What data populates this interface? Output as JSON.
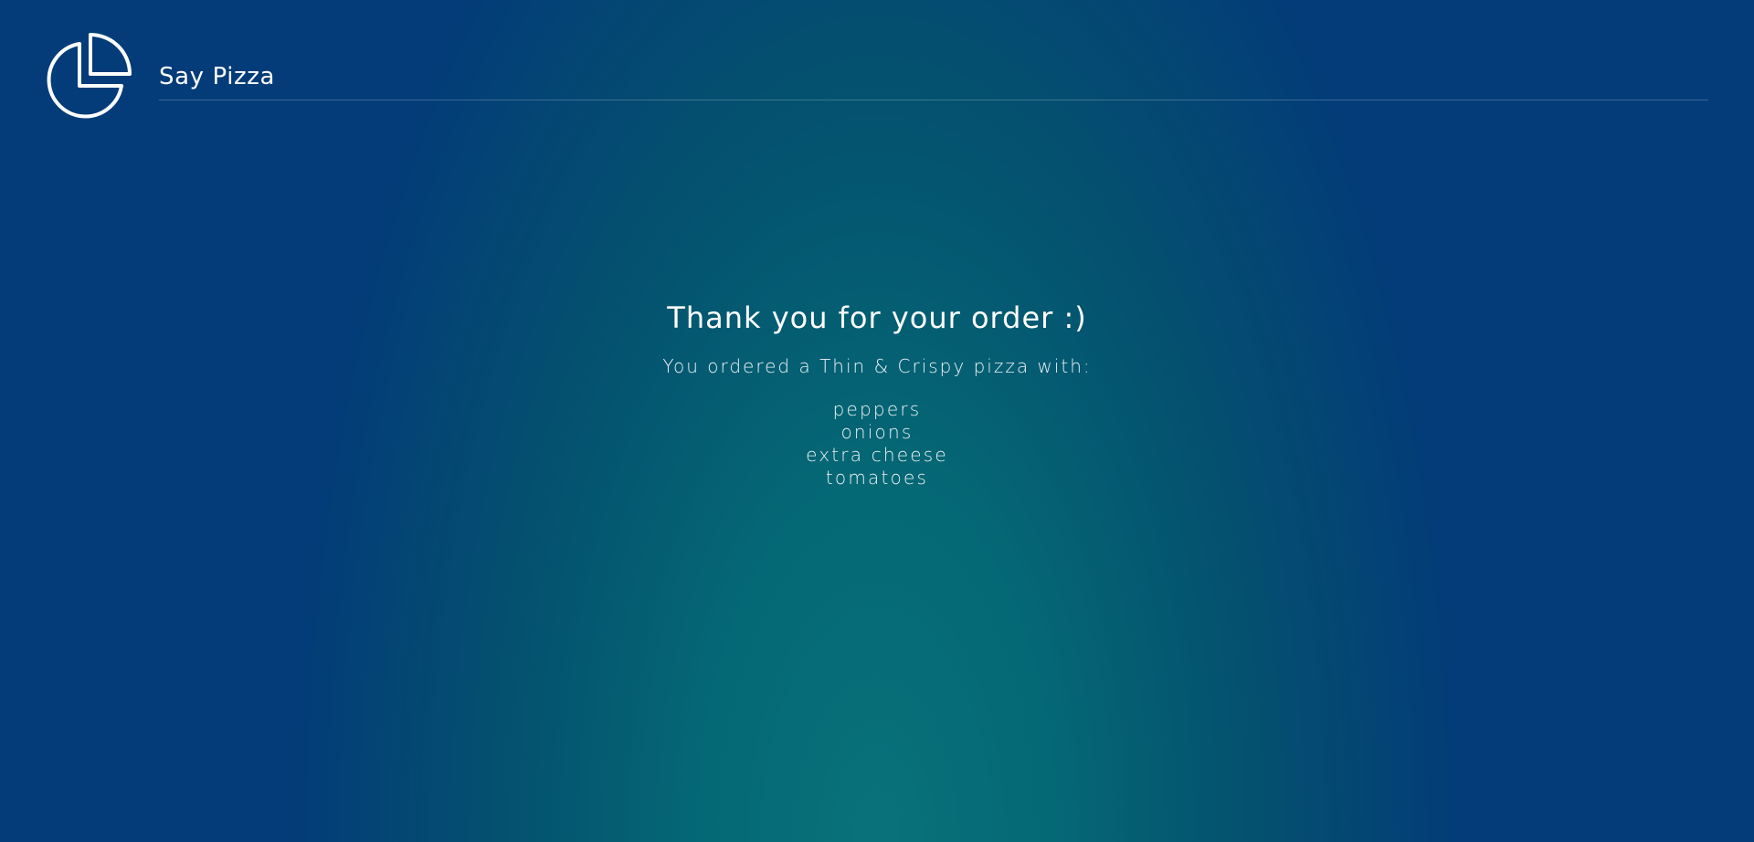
{
  "header": {
    "logo_icon": "pie-chart-icon",
    "brand": "Say Pizza"
  },
  "order": {
    "title": "Thank you for your order :)",
    "summary": "You ordered a Thin & Crispy pizza with:",
    "toppings": [
      "peppers",
      "onions",
      "extra cheese",
      "tomatoes"
    ]
  },
  "colors": {
    "background_center": "#08727a",
    "background_edge": "#033c78",
    "text": "#ffffff"
  }
}
